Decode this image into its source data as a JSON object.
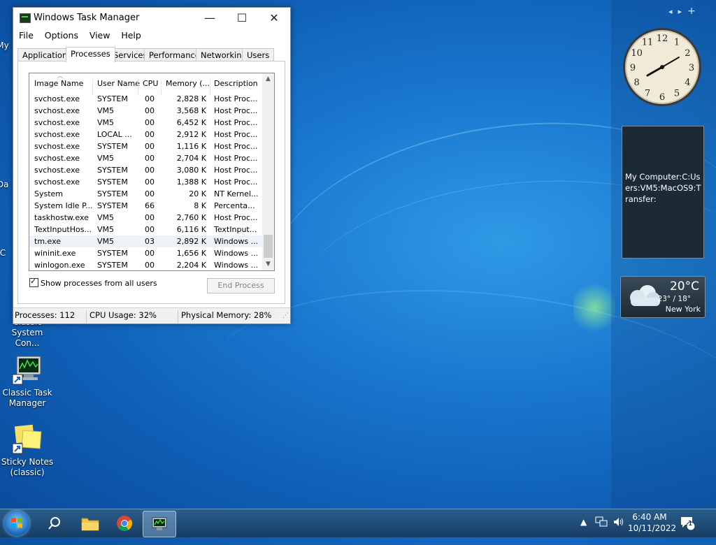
{
  "desktop": {
    "icons": [
      {
        "label": "Classic System Con..."
      },
      {
        "label": "Classic Task Manager"
      },
      {
        "label": "Sticky Notes (classic)"
      }
    ],
    "partial_labels": [
      "My",
      "Da",
      "C"
    ]
  },
  "window": {
    "title": "Windows Task Manager",
    "controls": {
      "minimize": "—",
      "maximize": "☐",
      "close": "✕"
    },
    "menu": [
      "File",
      "Options",
      "View",
      "Help"
    ],
    "tabs": [
      "Applications",
      "Processes",
      "Services",
      "Performance",
      "Networking",
      "Users"
    ],
    "active_tab": "Processes",
    "columns": [
      "Image Name",
      "User Name",
      "CPU",
      "Memory (...",
      "Description"
    ],
    "rows": [
      {
        "image": "svchost.exe",
        "user": "SYSTEM",
        "cpu": "00",
        "mem": "2,828 K",
        "desc": "Host Proc..."
      },
      {
        "image": "svchost.exe",
        "user": "VM5",
        "cpu": "00",
        "mem": "3,568 K",
        "desc": "Host Proc..."
      },
      {
        "image": "svchost.exe",
        "user": "VM5",
        "cpu": "00",
        "mem": "6,452 K",
        "desc": "Host Proc..."
      },
      {
        "image": "svchost.exe",
        "user": "LOCAL ...",
        "cpu": "00",
        "mem": "2,912 K",
        "desc": "Host Proc..."
      },
      {
        "image": "svchost.exe",
        "user": "SYSTEM",
        "cpu": "00",
        "mem": "1,116 K",
        "desc": "Host Proc..."
      },
      {
        "image": "svchost.exe",
        "user": "VM5",
        "cpu": "00",
        "mem": "2,704 K",
        "desc": "Host Proc..."
      },
      {
        "image": "svchost.exe",
        "user": "SYSTEM",
        "cpu": "00",
        "mem": "3,080 K",
        "desc": "Host Proc..."
      },
      {
        "image": "svchost.exe",
        "user": "SYSTEM",
        "cpu": "00",
        "mem": "1,388 K",
        "desc": "Host Proc..."
      },
      {
        "image": "System",
        "user": "SYSTEM",
        "cpu": "00",
        "mem": "20 K",
        "desc": "NT Kernel..."
      },
      {
        "image": "System Idle P...",
        "user": "SYSTEM",
        "cpu": "66",
        "mem": "8 K",
        "desc": "Percenta..."
      },
      {
        "image": "taskhostw.exe",
        "user": "VM5",
        "cpu": "00",
        "mem": "2,760 K",
        "desc": "Host Proc..."
      },
      {
        "image": "TextInputHos...",
        "user": "VM5",
        "cpu": "00",
        "mem": "6,116 K",
        "desc": "TextInput..."
      },
      {
        "image": "tm.exe",
        "user": "VM5",
        "cpu": "03",
        "mem": "2,892 K",
        "desc": "Windows ..."
      },
      {
        "image": "wininit.exe",
        "user": "SYSTEM",
        "cpu": "00",
        "mem": "1,656 K",
        "desc": "Windows ..."
      },
      {
        "image": "winlogon.exe",
        "user": "SYSTEM",
        "cpu": "00",
        "mem": "2,204 K",
        "desc": "Windows ..."
      }
    ],
    "selected_row": 12,
    "show_all_label": "Show processes from all users",
    "show_all_checked": true,
    "end_process_label": "End Process",
    "status": {
      "processes": "Processes: 112",
      "cpu": "CPU Usage: 32%",
      "memory": "Physical Memory: 28%"
    }
  },
  "gadgets": {
    "note_text": "My Computer:C:Users:VM5:MacOS9:Transfer:",
    "weather": {
      "temp": "20°C",
      "range": "23° / 18°",
      "city": "New York"
    },
    "clock_numbers": [
      "12",
      "1",
      "2",
      "3",
      "4",
      "5",
      "6",
      "7",
      "8",
      "9",
      "10",
      "11"
    ]
  },
  "taskbar": {
    "time": "6:40 AM",
    "date": "10/11/2022",
    "notification_count": "1"
  }
}
